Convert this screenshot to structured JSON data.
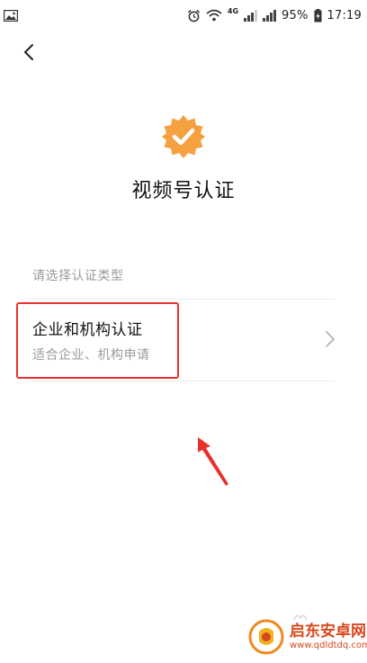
{
  "status_bar": {
    "battery": "95%",
    "time": "17:19",
    "network": "4G"
  },
  "header": {
    "back_icon": "chevron-left-icon"
  },
  "page": {
    "badge_icon": "verified-badge-icon",
    "badge_color": "#F5A142",
    "title": "视频号认证",
    "section_label": "请选择认证类型"
  },
  "option": {
    "title": "企业和机构认证",
    "subtitle": "适合企业、机构申请",
    "chevron_icon": "chevron-right-icon"
  },
  "annotations": {
    "highlight_color": "#e8312d",
    "arrow_color": "#e8312d"
  },
  "watermark": {
    "name": "启东安卓网",
    "url": "www.qdldtdq.com",
    "logo_icon": "site-logo-icon",
    "accent_color": "#d7481c"
  }
}
